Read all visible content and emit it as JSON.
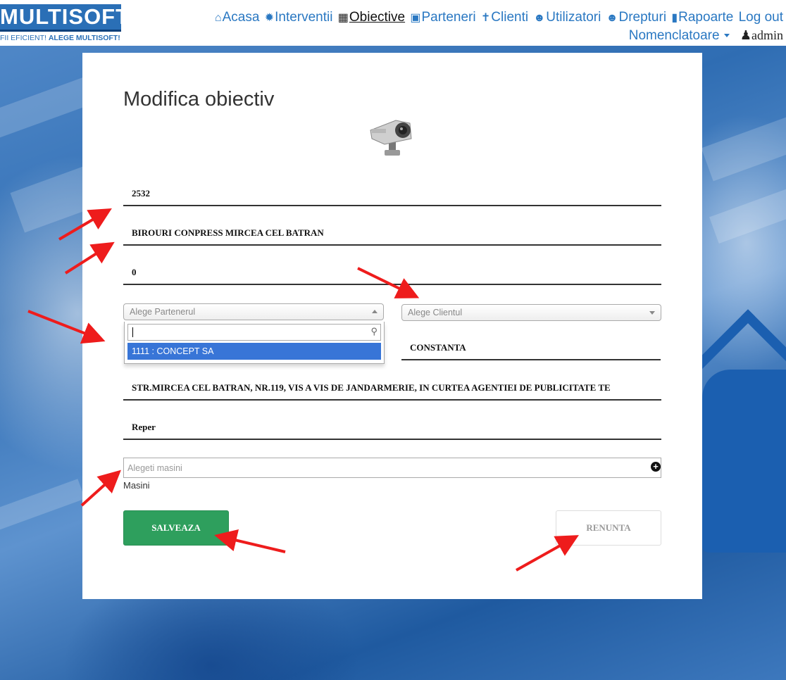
{
  "header": {
    "logo_text": "MULTISOFT",
    "logo_tagline_start": "FII EFICIENT!",
    "logo_tagline_brand": "ALEGE MULTISOFT!",
    "nav": [
      {
        "label": "Acasa",
        "icon": "home-icon"
      },
      {
        "label": "Interventii",
        "icon": "gear-icon"
      },
      {
        "label": "Obiective",
        "icon": "building-icon",
        "active": true
      },
      {
        "label": "Parteneri",
        "icon": "briefcase-icon"
      },
      {
        "label": "Clienti",
        "icon": "person-icon"
      },
      {
        "label": "Utilizatori",
        "icon": "users-icon"
      },
      {
        "label": "Drepturi",
        "icon": "users-icon"
      },
      {
        "label": "Rapoarte",
        "icon": "book-icon"
      }
    ],
    "logout_label": "Log out",
    "nomenclatoare_label": "Nomenclatoare",
    "user_label": "admin"
  },
  "form": {
    "title": "Modifica obiectiv",
    "image_icon": "security-camera-icon",
    "cod_value": "2532",
    "denumire_value": "BIROURI CONPRESS MIRCEA CEL BATRAN",
    "zero_value": "0",
    "partener_placeholder": "Alege Partenerul",
    "client_placeholder": "Alege Clientul",
    "partener_options": [
      "1111 : CONCEPT SA"
    ],
    "localitate_value": "CONSTANTA",
    "adresa_value": "STR.MIRCEA CEL BATRAN, NR.119, VIS A VIS DE JANDARMERIE, IN CURTEA AGENTIEI  DE PUBLICITATE TE",
    "reper_value": "Reper",
    "masini_placeholder": "Alegeti masini",
    "masini_label": "Masini",
    "save_label": "SALVEAZA",
    "cancel_label": "RENUNTA"
  },
  "colors": {
    "primary_blue": "#2a78c2",
    "save_green": "#2e9f5d",
    "annotation_red": "#ee1c1c",
    "highlight_blue": "#3875d7"
  }
}
